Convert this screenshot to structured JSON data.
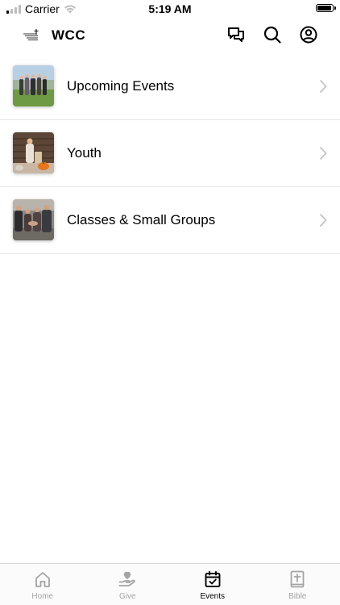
{
  "status_bar": {
    "carrier": "Carrier",
    "time": "5:19 AM",
    "battery_level": 0.9
  },
  "header": {
    "title": "WCC",
    "actions": [
      "chat-bubbles-icon",
      "search-icon",
      "account-icon"
    ]
  },
  "list": {
    "items": [
      {
        "label": "Upcoming Events",
        "thumbnail": "group-outdoors-photo"
      },
      {
        "label": "Youth",
        "thumbnail": "youth-fall-photo"
      },
      {
        "label": "Classes & Small Groups",
        "thumbnail": "small-group-photo"
      }
    ]
  },
  "tab_bar": {
    "active": "Events",
    "tabs": [
      {
        "label": "Home",
        "icon": "home-icon"
      },
      {
        "label": "Give",
        "icon": "give-icon"
      },
      {
        "label": "Events",
        "icon": "calendar-check-icon"
      },
      {
        "label": "Bible",
        "icon": "bible-icon"
      }
    ]
  },
  "colors": {
    "active_tab": "#000000",
    "inactive_tab": "#a4a4a4",
    "divider": "#e6e6e6",
    "chevron": "#c4c4c7"
  }
}
